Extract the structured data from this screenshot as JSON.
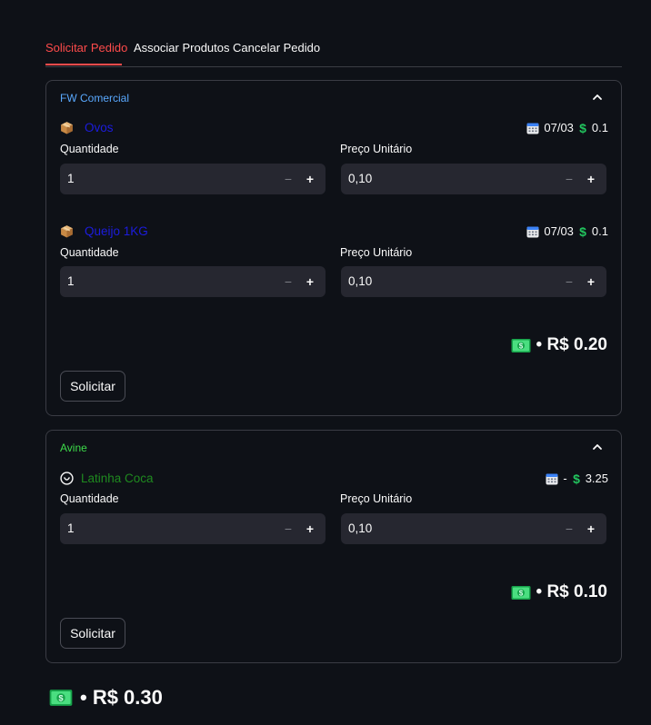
{
  "tabs": [
    {
      "label": "Solicitar Pedido",
      "active": true
    },
    {
      "label": "Associar Produtos",
      "active": false
    },
    {
      "label": "Cancelar Pedido",
      "active": false
    }
  ],
  "suppliers": [
    {
      "name": "FW Comercial",
      "name_color": "#5aa9ff",
      "products": [
        {
          "icon": "package-icon",
          "name": "Ovos",
          "name_color": "#1c1cde",
          "date": "07/03",
          "price": "0.1",
          "qty_label": "Quantidade",
          "qty": "1",
          "price_label": "Preço Unitário",
          "unit_price": "0,10"
        },
        {
          "icon": "package-icon",
          "name": "Queijo 1KG",
          "name_color": "#1c1cde",
          "date": "07/03",
          "price": "0.1",
          "qty_label": "Quantidade",
          "qty": "1",
          "price_label": "Preço Unitário",
          "unit_price": "0,10"
        }
      ],
      "subtotal": "• R$ 0.20",
      "button": "Solicitar"
    },
    {
      "name": "Avine",
      "name_color": "#3ddc4a",
      "products": [
        {
          "icon": "smiley-icon",
          "name": "Latinha Coca",
          "name_color": "#1f8a1f",
          "date": "-",
          "price": "3.25",
          "qty_label": "Quantidade",
          "qty": "1",
          "price_label": "Preço Unitário",
          "unit_price": "0,10"
        }
      ],
      "subtotal": "• R$ 0.10",
      "button": "Solicitar"
    }
  ],
  "grand_total": "• R$ 0.30",
  "step_minus": "−",
  "step_plus": "+"
}
